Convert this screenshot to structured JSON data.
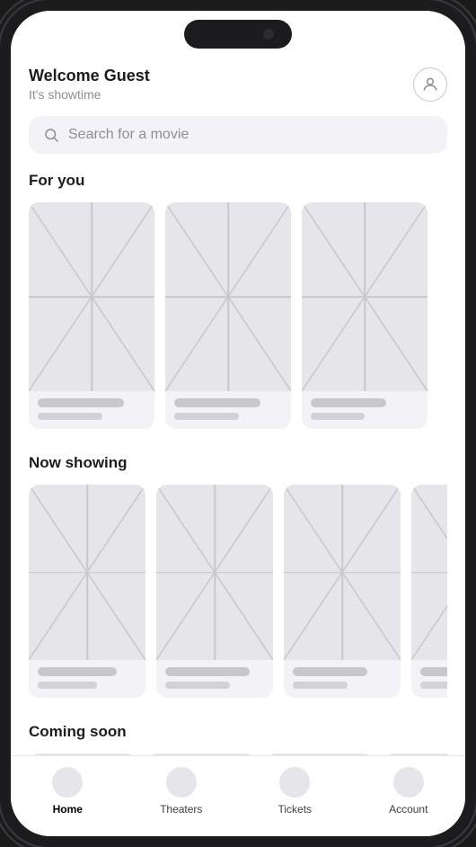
{
  "header": {
    "welcome": "Welcome Guest",
    "subtitle": "It's showtime"
  },
  "search": {
    "placeholder": "Search for a movie"
  },
  "sections": [
    {
      "id": "for-you",
      "title": "For you",
      "card_count": 3
    },
    {
      "id": "now-showing",
      "title": "Now showing",
      "card_count": 4
    },
    {
      "id": "coming-soon",
      "title": "Coming soon",
      "card_count": 4
    }
  ],
  "nav": {
    "items": [
      {
        "id": "home",
        "label": "Home",
        "active": true
      },
      {
        "id": "theaters",
        "label": "Theaters",
        "active": false
      },
      {
        "id": "tickets",
        "label": "Tickets",
        "active": false
      },
      {
        "id": "account",
        "label": "Account",
        "active": false
      }
    ]
  }
}
